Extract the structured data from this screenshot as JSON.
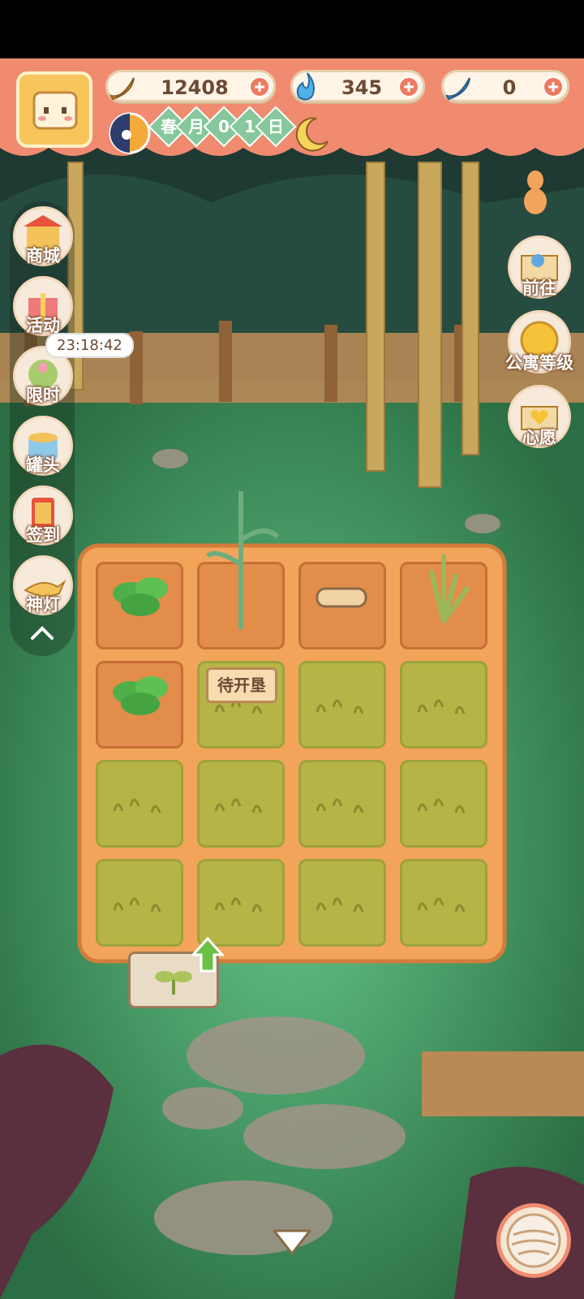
{
  "currencies": [
    {
      "icon": "banana-icon",
      "value": "12408"
    },
    {
      "icon": "blue-flame-icon",
      "value": "345"
    },
    {
      "icon": "blue-banana-icon",
      "value": "0"
    }
  ],
  "date": {
    "season": "春",
    "month": "月",
    "day_digit_1": "0",
    "day_digit_2": "1",
    "day": "日"
  },
  "left_menu": [
    {
      "label": "商城",
      "icon": "shop-icon"
    },
    {
      "label": "活动",
      "icon": "gift-icon"
    },
    {
      "label": "限时",
      "icon": "limited-icon"
    },
    {
      "label": "罐头",
      "icon": "can-icon"
    },
    {
      "label": "签到",
      "icon": "checkin-icon"
    },
    {
      "label": "神灯",
      "icon": "magic-lamp-icon"
    }
  ],
  "timer": "23:18:42",
  "right_menu": [
    {
      "label": "前往",
      "icon": "map-icon"
    },
    {
      "label": "公寓等级",
      "icon": "sun-level-icon"
    },
    {
      "label": "心愿",
      "icon": "heart-book-icon"
    }
  ],
  "farm": {
    "unlock_sign": "待开垦",
    "plots": [
      {
        "state": "soil",
        "crop": "leafy"
      },
      {
        "state": "soil",
        "crop": "corn"
      },
      {
        "state": "soil",
        "crop": "log"
      },
      {
        "state": "soil",
        "crop": "grass-sprout"
      },
      {
        "state": "soil",
        "crop": "leafy"
      },
      {
        "state": "locked"
      },
      {
        "state": "locked"
      },
      {
        "state": "locked"
      },
      {
        "state": "locked"
      },
      {
        "state": "locked"
      },
      {
        "state": "locked"
      },
      {
        "state": "locked"
      },
      {
        "state": "locked"
      },
      {
        "state": "locked"
      },
      {
        "state": "locked"
      },
      {
        "state": "locked"
      }
    ]
  },
  "colors": {
    "header": "#f08b6f",
    "plus": "#ef7a5d",
    "soil": "#e38d4b",
    "grass": "#b7b447",
    "bg": "#2f7d4f"
  }
}
